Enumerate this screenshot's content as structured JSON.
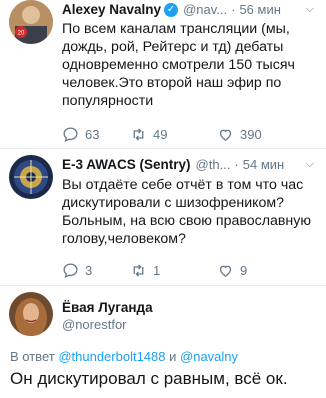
{
  "tweets": [
    {
      "name": "Alexey Navalny",
      "handle": "@nav...",
      "time": "56 мин",
      "text": "По всем каналам трансляции (мы, дождь, рой, Рейтерс и тд) дебаты одновременно смотрели 150 тысяч человек.Это второй наш эфир по популярности",
      "replies": "63",
      "retweets": "49",
      "likes": "390"
    },
    {
      "name": "E-3 AWACS (Sentry)",
      "handle": "@th...",
      "time": "54 мин",
      "text": "Вы отдаёте себе отчёт в том что час дискутировали с шизофреником? Больным, на всю свою православную голову,человеком?",
      "replies": "3",
      "retweets": "1",
      "likes": "9"
    }
  ],
  "main_tweet": {
    "name": "Ёвая Луганда",
    "handle": "@norestfor",
    "reply_prefix": "В ответ",
    "reply_user1": "@thunderbolt1488",
    "reply_and": "и",
    "reply_user2": "@navalny",
    "text": "Он дискутировал с равным, всё ок."
  },
  "colors": {
    "accent": "#1da1f2",
    "muted": "#657786",
    "text": "#14171a"
  }
}
